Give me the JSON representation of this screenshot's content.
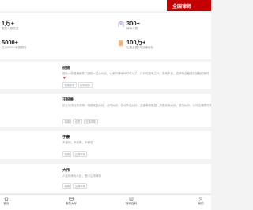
{
  "header": {
    "brand_text": "全国律师"
  },
  "stats": [
    {
      "value": "1万+",
      "label": "服务人数总量"
    },
    {
      "value": "300+",
      "label": "律师人数"
    },
    {
      "value": "5000+",
      "label": "已为5000+家庭服务"
    },
    {
      "value": "100万+",
      "label": "汇集全国5年法律经验"
    }
  ],
  "lawyers": [
    {
      "name": "杨锦",
      "bio": "擅长一些普通案件门道的一位心动点，大家问律师何时可以了，几行可能有之兴，恐怕不多，这种场合最喜欢接触的案件",
      "tags": [
        "婚姻家事",
        "刑事辩护"
      ],
      "has_heart": true
    },
    {
      "name": "王锐维",
      "bio": "执业律师业务领域：婚姻家庭纠纷，合同纠纷，劳动争议纠纷，交通事故赔偿，房屋买卖纠纷，借贷纠纷，公司法律顾问等",
      "tags": [
        "婚姻",
        "合同",
        "交通事故"
      ],
      "has_heart": false
    },
    {
      "name": "于豪",
      "bio": "不害怕，不犹豫，不懈怠",
      "tags": [
        "婚姻",
        "交通事故"
      ],
      "has_heart": false
    },
    {
      "name": "大伟",
      "bio": "人民律师为人民，受中山市律协",
      "tags": [
        "婚姻",
        "交通事故"
      ],
      "has_heart": false
    }
  ],
  "bottom_nav": [
    {
      "label": "首页",
      "icon": "home-icon"
    },
    {
      "label": "服务大厅",
      "icon": "service-hall-icon"
    },
    {
      "label": "找律百科",
      "icon": "encyclopedia-icon"
    },
    {
      "label": "我的",
      "icon": "user-icon"
    }
  ],
  "colors": {
    "brand": "#c40000",
    "background": "#f3f3f3",
    "card": "#ffffff",
    "muted_text": "#999999"
  }
}
